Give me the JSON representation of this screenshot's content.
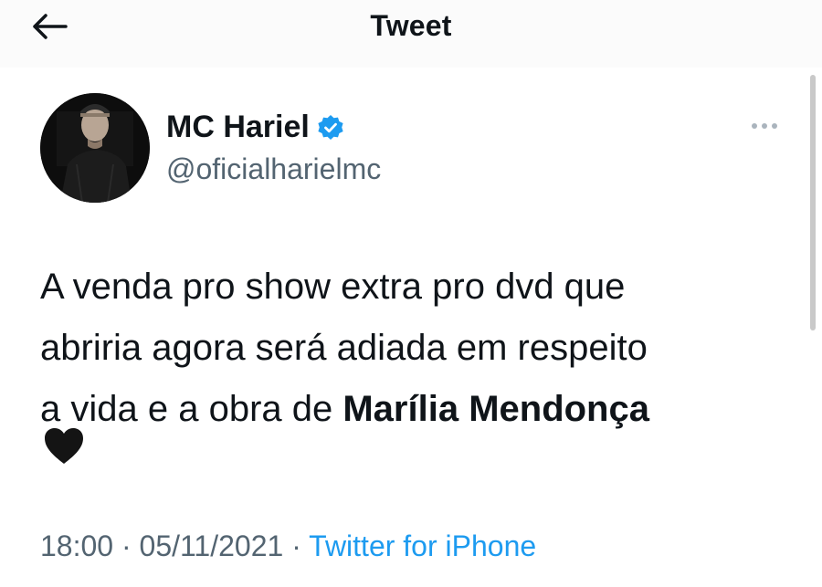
{
  "header": {
    "title": "Tweet",
    "back_icon": "arrow-left-icon"
  },
  "author": {
    "name": "MC Hariel",
    "handle": "@oficialharielmc",
    "verified": true,
    "verified_color": "#1d9bf0"
  },
  "tweet": {
    "line1": "A venda pro show extra pro dvd que",
    "line2": "abriria agora será adiada em respeito",
    "line3_prefix": "a vida e a obra de ",
    "line3_bold": "Marília Mendonça",
    "emoji": "black-heart-icon"
  },
  "meta": {
    "time": "18:00",
    "separator": " · ",
    "date": "05/11/2021",
    "source": "Twitter for iPhone",
    "source_color": "#1d9bf0"
  }
}
